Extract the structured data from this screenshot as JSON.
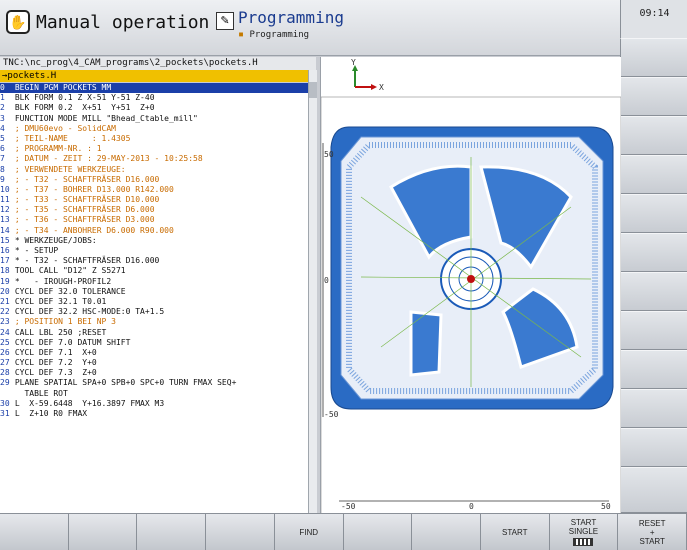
{
  "header": {
    "mode_title": "Manual operation",
    "prog_title": "Programming",
    "prog_subtitle": "Programming",
    "clock": "09:14"
  },
  "editor": {
    "path": "TNC:\\nc_prog\\4_CAM_programs\\2_pockets\\pockets.H",
    "file": "→pockets.H",
    "lines": [
      {
        "n": "0",
        "t": "BEGIN PGM POCKETS MM",
        "sel": true
      },
      {
        "n": "1",
        "t": "BLK FORM 0.1 Z X-51 Y-51 Z-40"
      },
      {
        "n": "2",
        "t": "BLK FORM 0.2  X+51  Y+51  Z+0"
      },
      {
        "n": "3",
        "t": "FUNCTION MODE MILL \"Bhead_Ctable_mill\""
      },
      {
        "n": "4",
        "t": "; DMU60evo - SolidCAM",
        "c": true
      },
      {
        "n": "5",
        "t": "; TEIL-NAME     : 1.4305",
        "c": true
      },
      {
        "n": "6",
        "t": "; PROGRAMM-NR. : 1",
        "c": true
      },
      {
        "n": "7",
        "t": "; DATUM - ZEIT : 29-MAY-2013 - 10:25:58",
        "c": true
      },
      {
        "n": "8",
        "t": "; VERWENDETE WERKZEUGE:",
        "c": true
      },
      {
        "n": "9",
        "t": "; - T32 - SCHAFTFRÄSER D16.000",
        "c": true
      },
      {
        "n": "10",
        "t": "; - T37 - BOHRER D13.000 R142.000",
        "c": true
      },
      {
        "n": "11",
        "t": "; - T33 - SCHAFTFRÄSER D10.000",
        "c": true
      },
      {
        "n": "12",
        "t": "; - T35 - SCHAFTFRÄSER D6.000",
        "c": true
      },
      {
        "n": "13",
        "t": "; - T36 - SCHAFTFRÄSER D3.000",
        "c": true
      },
      {
        "n": "14",
        "t": "; - T34 - ANBOHRER D6.000 R90.000",
        "c": true
      },
      {
        "n": "15",
        "t": "* WERKZEUGE/JOBS:"
      },
      {
        "n": "16",
        "t": "* - SETUP"
      },
      {
        "n": "17",
        "t": "* - T32 - SCHAFTFRÄSER D16.000"
      },
      {
        "n": "18",
        "t": "TOOL CALL \"D12\" Z S5271"
      },
      {
        "n": "19",
        "t": "*   - IROUGH-PROFIL2"
      },
      {
        "n": "20",
        "t": "CYCL DEF 32.0 TOLERANCE"
      },
      {
        "n": "21",
        "t": "CYCL DEF 32.1 T0.01"
      },
      {
        "n": "22",
        "t": "CYCL DEF 32.2 HSC-MODE:0 TA+1.5"
      },
      {
        "n": "23",
        "t": "; POSITION 1 BEI NP 3",
        "c": true
      },
      {
        "n": "24",
        "t": "CALL LBL 250 ;RESET"
      },
      {
        "n": "25",
        "t": "CYCL DEF 7.0 DATUM SHIFT"
      },
      {
        "n": "26",
        "t": "CYCL DEF 7.1  X+0"
      },
      {
        "n": "27",
        "t": "CYCL DEF 7.2  Y+0"
      },
      {
        "n": "28",
        "t": "CYCL DEF 7.3  Z+0"
      },
      {
        "n": "29",
        "t": "PLANE SPATIAL SPA+0 SPB+0 SPC+0 TURN FMAX SEQ+"
      },
      {
        "n": "",
        "t": "  TABLE ROT"
      },
      {
        "n": "30",
        "t": "L  X-59.6448  Y+16.3897 FMAX M3"
      },
      {
        "n": "31",
        "t": "L  Z+10 R0 FMAX"
      }
    ]
  },
  "graphic": {
    "axis_y": "Y",
    "axis_x": "X",
    "scale_left": "-50",
    "scale_mid": "0",
    "scale_right": "50",
    "side_top": "50",
    "side_mid": "0",
    "side_bot": "-50",
    "accent": "#1a5ab8"
  },
  "softkeys": [
    "",
    "",
    "",
    "",
    "FIND",
    "",
    "",
    "START",
    "START\nSINGLE",
    "RESET\n+\nSTART"
  ]
}
